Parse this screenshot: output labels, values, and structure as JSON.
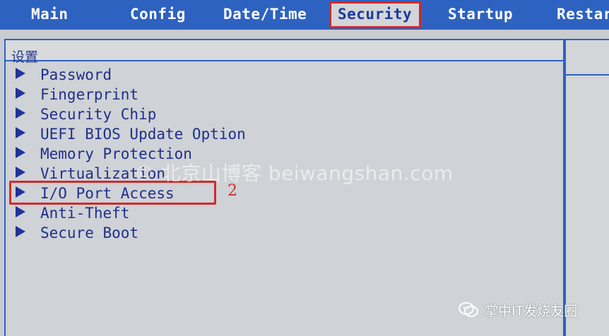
{
  "tabs": [
    {
      "label": "Main"
    },
    {
      "label": "Config"
    },
    {
      "label": "Date/Time"
    },
    {
      "label": "Security"
    },
    {
      "label": "Startup"
    },
    {
      "label": "Restar"
    }
  ],
  "selected_tab": "Security",
  "menu": {
    "items": [
      {
        "label": "Password"
      },
      {
        "label": "Fingerprint"
      },
      {
        "label": "Security Chip"
      },
      {
        "label": "UEFI BIOS Update Option"
      },
      {
        "label": "Memory Protection"
      },
      {
        "label": "Virtualization"
      },
      {
        "label": "I/O Port Access"
      },
      {
        "label": "Anti-Theft"
      },
      {
        "label": "Secure Boot"
      }
    ],
    "highlighted_item": "I/O Port Access"
  },
  "side_panel": {
    "text": "设置"
  },
  "annotations": {
    "step_number": "2"
  },
  "watermark": "© 北京山博客 beiwangshan.com",
  "footer": {
    "badge_text": "掌中IT发烧友圈",
    "icon": "wechat-icon"
  },
  "colors": {
    "tabbar": "#2e62c0",
    "highlight": "#d12a2a",
    "menu_text": "#1f2f8a",
    "background": "#c8ccd0"
  }
}
